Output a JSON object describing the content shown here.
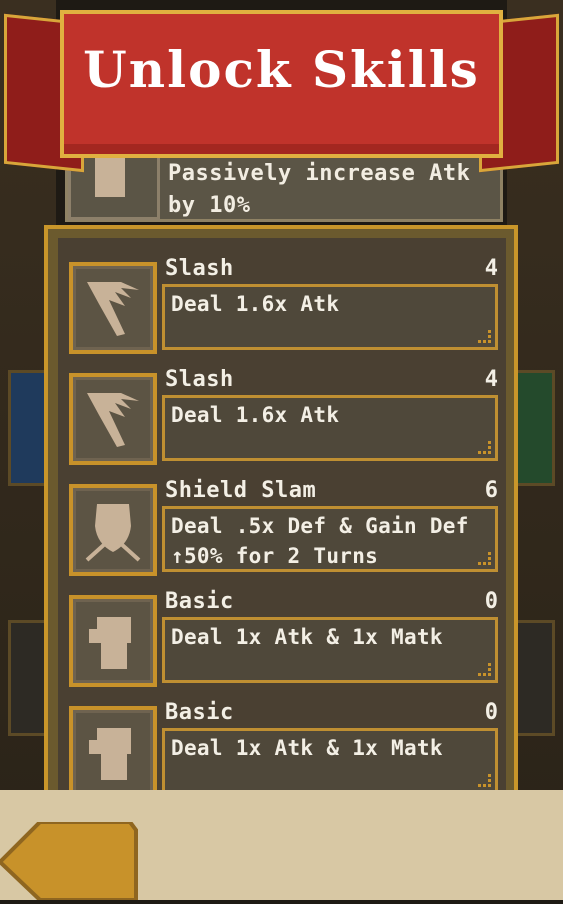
{
  "header": {
    "title": "Unlock Skills"
  },
  "top_card": {
    "description": "Passively increase Atk by 10%"
  },
  "skills": [
    {
      "name": "Slash",
      "cost": "4",
      "description": "Deal 1.6x Atk",
      "icon": "slash-icon"
    },
    {
      "name": "Slash",
      "cost": "4",
      "description": "Deal 1.6x Atk",
      "icon": "slash-icon"
    },
    {
      "name": "Shield Slam",
      "cost": "6",
      "description": "Deal .5x Def & Gain Def ↑50% for 2 Turns",
      "icon": "shield-icon"
    },
    {
      "name": "Basic",
      "cost": "0",
      "description": "Deal 1x Atk & 1x Matk",
      "icon": "fist-icon"
    },
    {
      "name": "Basic",
      "cost": "0",
      "description": "Deal 1x Atk & 1x Matk",
      "icon": "fist-icon"
    }
  ],
  "colors": {
    "banner": "#c0332b",
    "gold": "#c8922a",
    "panel": "#4f483a"
  }
}
